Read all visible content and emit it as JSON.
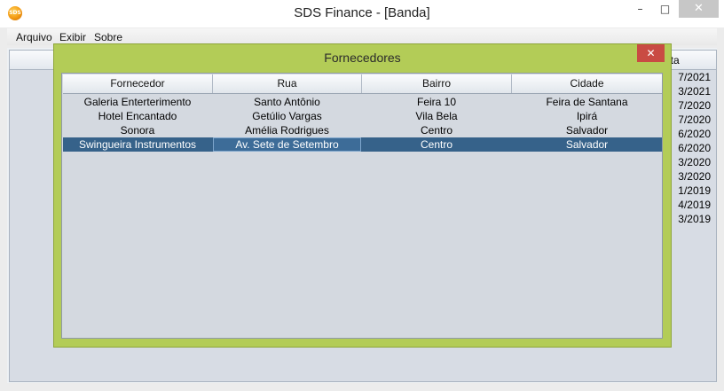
{
  "window": {
    "title": "SDS Finance - [Banda]",
    "icon_text": "SDS",
    "minimize": "–",
    "maximize": "□",
    "close": "✕"
  },
  "menu": [
    "Arquivo",
    "Exibir",
    "Sobre"
  ],
  "main_table": {
    "header_fragment": "ata",
    "dates": [
      "7/2021",
      "3/2021",
      "7/2020",
      "7/2020",
      "6/2020",
      "6/2020",
      "3/2020",
      "3/2020",
      "1/2019",
      "4/2019",
      "3/2019"
    ]
  },
  "dialog": {
    "title": "Fornecedores",
    "close": "✕",
    "columns": [
      "Fornecedor",
      "Rua",
      "Bairro",
      "Cidade"
    ],
    "rows": [
      [
        "Galeria Enterterimento",
        "Santo Antônio",
        "Feira 10",
        "Feira de Santana"
      ],
      [
        "Hotel Encantado",
        "Getúlio Vargas",
        "Vila Bela",
        "Ipirá"
      ],
      [
        "Sonora",
        "Amélia Rodrigues",
        "Centro",
        "Salvador"
      ],
      [
        "Swingueira Instrumentos",
        "Av. Sete de Setembro",
        "Centro",
        "Salvador"
      ]
    ],
    "selected_row": 3
  }
}
